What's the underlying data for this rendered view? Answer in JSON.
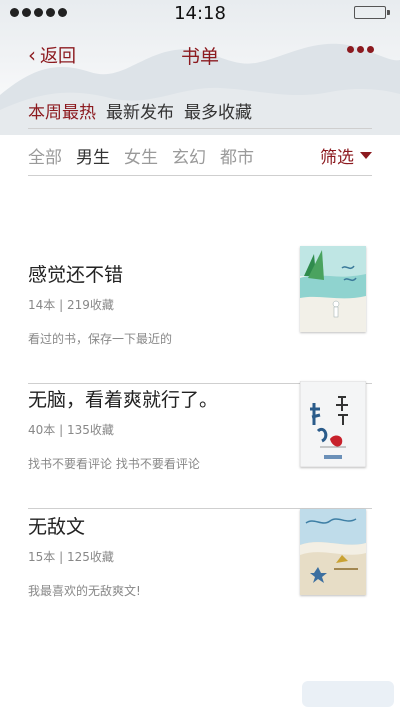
{
  "status_bar": {
    "time": "14:18"
  },
  "nav": {
    "back_label": "返回",
    "title": "书单"
  },
  "sort_tabs": [
    {
      "label": "本周最热",
      "active": true
    },
    {
      "label": "最新发布",
      "active": false
    },
    {
      "label": "最多收藏",
      "active": false
    }
  ],
  "category_tabs": [
    {
      "label": "全部",
      "active": false
    },
    {
      "label": "男生",
      "active": true
    },
    {
      "label": "女生",
      "active": false
    },
    {
      "label": "玄幻",
      "active": false
    },
    {
      "label": "都市",
      "active": false
    }
  ],
  "filter_label": "筛选",
  "book_lists": [
    {
      "title": "感觉还不错",
      "meta": "14本 | 219收藏",
      "desc": "看过的书，保存一下最近的",
      "cover_icon": "beach-sea-cover"
    },
    {
      "title": "无脑，看着爽就行了。",
      "meta": "40本 | 135收藏",
      "desc": "找书不要看评论 找书不要看评论",
      "cover_icon": "calligraphy-cover"
    },
    {
      "title": "无敌文",
      "meta": "15本 | 125收藏",
      "desc": "我最喜欢的无敌爽文!",
      "cover_icon": "starfish-sand-cover"
    }
  ],
  "colors": {
    "accent": "#8c1a1f",
    "divider": "#cfcfcf",
    "muted": "#888888"
  }
}
